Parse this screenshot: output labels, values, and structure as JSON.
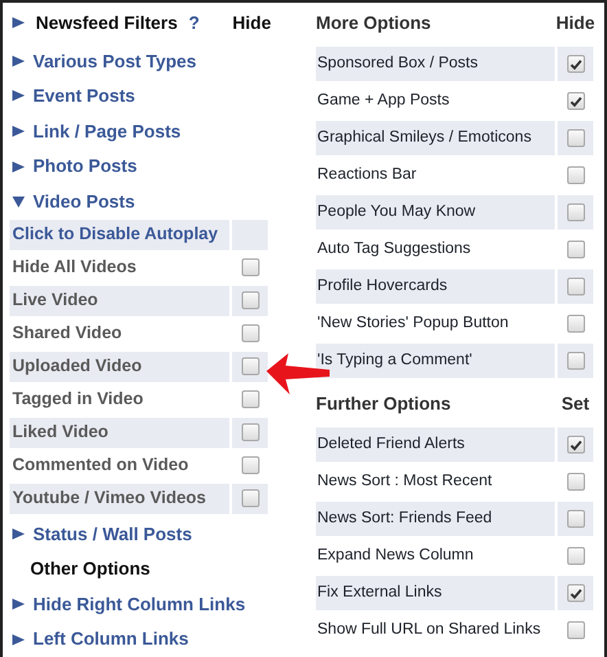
{
  "left": {
    "title": "Newsfeed Filters",
    "help": "?",
    "column_label": "Hide",
    "sections": [
      {
        "label": "Various Post Types",
        "expanded": false
      },
      {
        "label": "Event Posts",
        "expanded": false
      },
      {
        "label": "Link / Page Posts",
        "expanded": false
      },
      {
        "label": "Photo Posts",
        "expanded": false
      },
      {
        "label": "Video Posts",
        "expanded": true,
        "rows": [
          {
            "kind": "action",
            "label": "Click to Disable Autoplay"
          },
          {
            "kind": "checkbox",
            "label": "Hide All Videos",
            "checked": false
          },
          {
            "kind": "checkbox",
            "label": "Live Video",
            "checked": false
          },
          {
            "kind": "checkbox",
            "label": "Shared Video",
            "checked": false
          },
          {
            "kind": "checkbox",
            "label": "Uploaded Video",
            "checked": false
          },
          {
            "kind": "checkbox",
            "label": "Tagged in Video",
            "checked": false
          },
          {
            "kind": "checkbox",
            "label": "Liked Video",
            "checked": false
          },
          {
            "kind": "checkbox",
            "label": "Commented on Video",
            "checked": false
          },
          {
            "kind": "checkbox",
            "label": "Youtube / Vimeo Videos",
            "checked": false
          }
        ]
      },
      {
        "label": "Status / Wall Posts",
        "expanded": false
      }
    ],
    "other_title": "Other Options",
    "other_sections": [
      {
        "label": "Hide Right Column Links",
        "expanded": false
      },
      {
        "label": "Left Column Links",
        "expanded": false
      }
    ]
  },
  "right": [
    {
      "title": "More Options",
      "column_label": "Hide",
      "items": [
        {
          "label": "Sponsored Box / Posts",
          "checked": true
        },
        {
          "label": "Game + App Posts",
          "checked": true
        },
        {
          "label": "Graphical Smileys / Emoticons",
          "checked": false
        },
        {
          "label": "Reactions Bar",
          "checked": false
        },
        {
          "label": "People You May Know",
          "checked": false
        },
        {
          "label": "Auto Tag Suggestions",
          "checked": false
        },
        {
          "label": "Profile Hovercards",
          "checked": false
        },
        {
          "label": "'New Stories' Popup Button",
          "checked": false
        },
        {
          "label": "'Is Typing a Comment'",
          "checked": false
        }
      ]
    },
    {
      "title": "Further Options",
      "column_label": "Set",
      "items": [
        {
          "label": "Deleted Friend Alerts",
          "checked": true
        },
        {
          "label": "News Sort : Most Recent",
          "checked": false
        },
        {
          "label": "News Sort: Friends Feed",
          "checked": false
        },
        {
          "label": "Expand News Column",
          "checked": false
        },
        {
          "label": "Fix External Links",
          "checked": true
        },
        {
          "label": "Show Full URL on Shared Links",
          "checked": false
        }
      ]
    }
  ]
}
